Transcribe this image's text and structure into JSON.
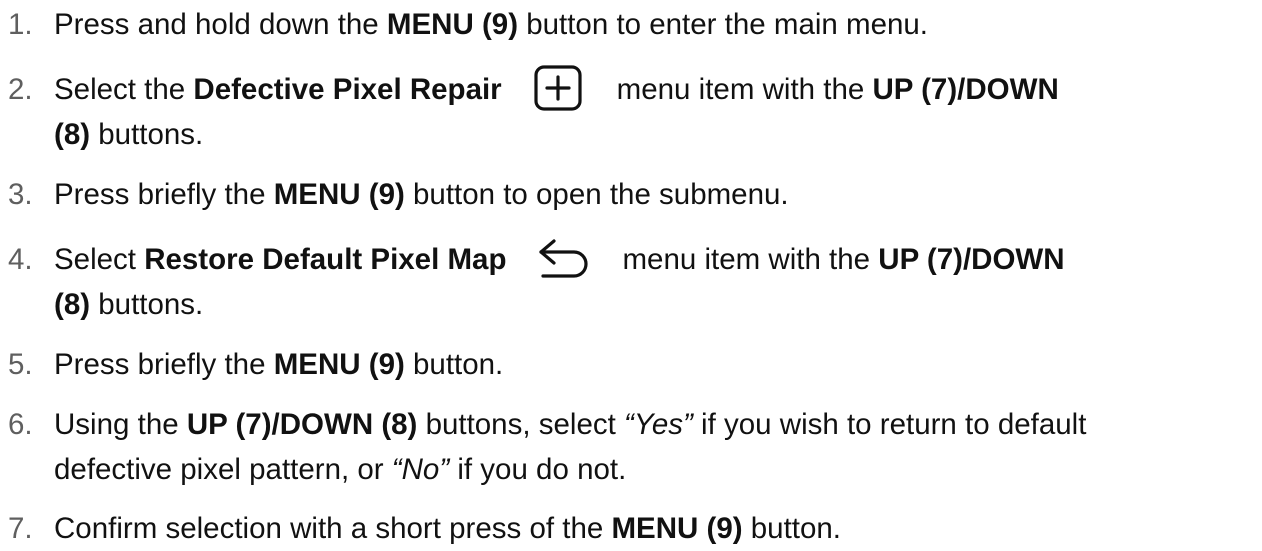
{
  "steps": [
    {
      "num": "1.",
      "a": "Press and hold down the ",
      "b": "MENU (9)",
      "c": " button to enter the main menu."
    },
    {
      "num": "2.",
      "a": "Select the ",
      "b": "Defective Pixel Repair",
      "icon": "plus-square-icon",
      "c": "menu item with the ",
      "d": "UP (7)/DOWN",
      "e": "(8)",
      "f": " buttons."
    },
    {
      "num": "3.",
      "a": "Press briefly the ",
      "b": "MENU (9)",
      "c": " button to open the submenu."
    },
    {
      "num": "4.",
      "a": "Select ",
      "b": "Restore Default Pixel Map",
      "icon": "undo-arrow-icon",
      "c": "menu item with the ",
      "d": "UP (7)/DOWN",
      "e": "(8)",
      "f": " buttons."
    },
    {
      "num": "5.",
      "a": "Press briefly the ",
      "b": "MENU (9)",
      "c": " button."
    },
    {
      "num": "6.",
      "a": "Using the ",
      "b": "UP (7)/DOWN (8)",
      "c": " buttons, select ",
      "d": "“Yes”",
      "e": " if you wish to return to default",
      "f": "defective pixel pattern, or ",
      "g": "“No”",
      "h": " if you do not."
    },
    {
      "num": "7.",
      "a": "Confirm selection with a short press of the ",
      "b": "MENU (9)",
      "c": " button."
    }
  ]
}
